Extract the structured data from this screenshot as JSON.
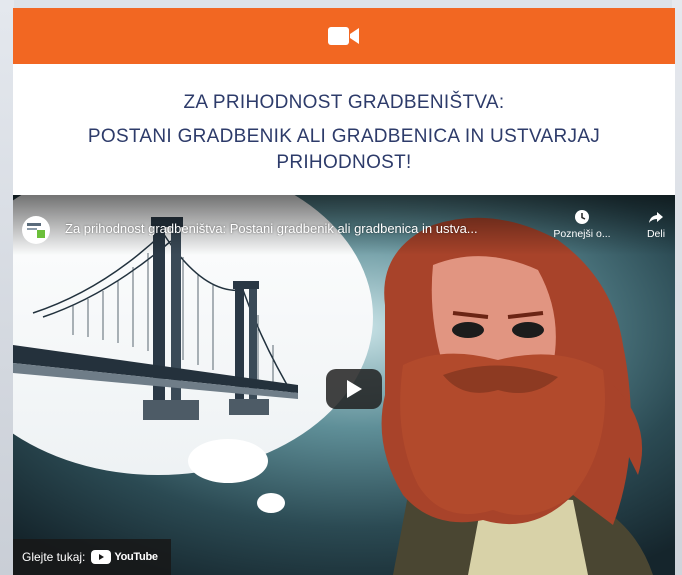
{
  "header": {
    "icon": "video-camera-icon",
    "bg_color": "#f26722"
  },
  "title": {
    "line1": "ZA PRIHODNOST GRADBENIŠTVA:",
    "line2": "POSTANI GRADBENIK ALI GRADBENICA IN USTVARJAJ PRIHODNOST!",
    "color": "#2d3b6a"
  },
  "video": {
    "title": "Za prihodnost gradbeništva: Postani gradbenik ali gradbenica in ustva...",
    "watch_later_label": "Poznejši o...",
    "share_label": "Deli",
    "watch_on_label": "Glejte tukaj:",
    "youtube_label": "YouTube"
  }
}
